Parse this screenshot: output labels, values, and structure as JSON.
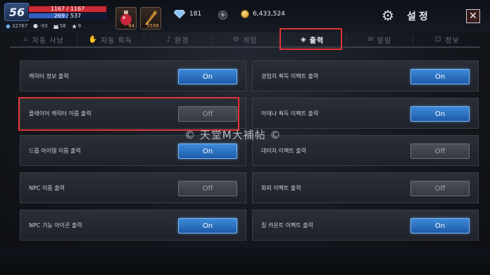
{
  "hud": {
    "level": "56",
    "hp_text": "1167 / 1167",
    "hp_fraction": 1.0,
    "mp_text": "269 / 537",
    "mp_fraction": 0.5,
    "stats": [
      "32767",
      "-93",
      "58",
      "9"
    ],
    "potion_count": "94",
    "scroll_count": "5556",
    "crystal_count": "181",
    "adena": "6,433,524",
    "title": "설정",
    "close_label": "✕"
  },
  "tabs": [
    {
      "label": "자동 사냥",
      "icon": "sword-icon",
      "active": false
    },
    {
      "label": "자동 획득",
      "icon": "hand-icon",
      "active": false
    },
    {
      "label": "환경",
      "icon": "music-icon",
      "active": false
    },
    {
      "label": "게임",
      "icon": "gear-icon",
      "active": false
    },
    {
      "label": "출력",
      "icon": "cube-icon",
      "active": true
    },
    {
      "label": "알림",
      "icon": "megaphone-icon",
      "active": false
    },
    {
      "label": "정보",
      "icon": "person-icon",
      "active": false
    }
  ],
  "left_settings": [
    {
      "label": "캐릭터 정보 출력",
      "state": "On"
    },
    {
      "label": "플레이어 캐릭터 이름 출력",
      "state": "Off"
    },
    {
      "label": "드롭 아이템 이름 출력",
      "state": "On"
    },
    {
      "label": "NPC 이름 출력",
      "state": "Off"
    },
    {
      "label": "NPC 기능 아이콘 출력",
      "state": "On"
    }
  ],
  "right_settings": [
    {
      "label": "경험치 획득 이펙트 출력",
      "state": "On"
    },
    {
      "label": "아데나 획득 이펙트 출력",
      "state": "On"
    },
    {
      "label": "대미지 이펙트 출력",
      "state": "Off"
    },
    {
      "label": "회피 이펙트 출력",
      "state": "Off"
    },
    {
      "label": "킬 카운트 이펙트 출력",
      "state": "On"
    }
  ],
  "watermark": "© 天堂M大補帖 ©",
  "colors": {
    "toggle_on": "#2a70c0",
    "toggle_off": "#43464d",
    "highlight": "#e23535"
  }
}
